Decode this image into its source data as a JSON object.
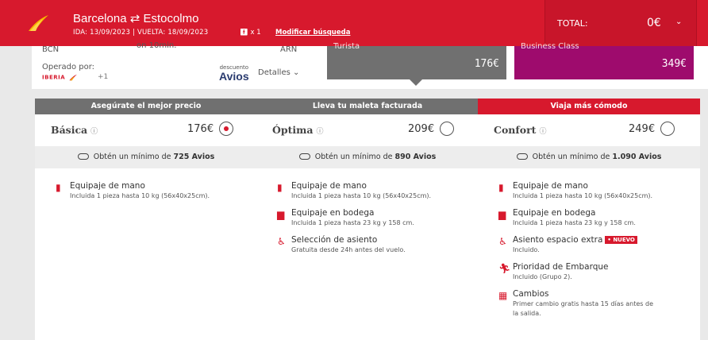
{
  "header": {
    "route": "Barcelona ⇄ Estocolmo",
    "dates": "IDA: 13/09/2023 | VUELTA: 18/09/2023",
    "pax": "x 1",
    "modify": "Modificar búsqueda",
    "total_label": "TOTAL:",
    "total_value": "0€"
  },
  "flight": {
    "origin": "BCN",
    "destination": "ARN",
    "duration": "on 10min.",
    "operated_label": "Operado por:",
    "airline": "IBERIA",
    "extra_carriers": "+1",
    "avios_top": "descuento",
    "avios_brand": "Avios",
    "details": "Detalles"
  },
  "fare_summary": [
    {
      "name": "Turista",
      "price": "176€"
    },
    {
      "name": "Business Class",
      "price": "349€"
    }
  ],
  "cards": [
    {
      "banner": "Asegúrate el mejor precio",
      "name": "Básica",
      "price": "176€",
      "avios_prefix": "Obtén un mínimo de",
      "avios_value": "725 Avios",
      "features": [
        {
          "title": "Equipaje de mano",
          "sub": "Incluida 1 pieza hasta 10 kg (56x40x25cm)."
        }
      ]
    },
    {
      "banner": "Lleva tu maleta facturada",
      "name": "Óptima",
      "price": "209€",
      "avios_prefix": "Obtén un mínimo de",
      "avios_value": "890 Avios",
      "features": [
        {
          "title": "Equipaje de mano",
          "sub": "Incluida 1 pieza hasta 10 kg (56x40x25cm)."
        },
        {
          "title": "Equipaje en bodega",
          "sub": "Incluida 1 pieza hasta 23 kg y 158 cm."
        },
        {
          "title": "Selección de asiento",
          "sub": "Gratuita desde 24h antes del vuelo."
        }
      ]
    },
    {
      "banner": "Viaja más cómodo",
      "name": "Confort",
      "price": "249€",
      "avios_prefix": "Obtén un mínimo de",
      "avios_value": "1.090 Avios",
      "features": [
        {
          "title": "Equipaje de mano",
          "sub": "Incluida 1 pieza hasta 10 kg (56x40x25cm)."
        },
        {
          "title": "Equipaje en bodega",
          "sub": "Incluida 1 pieza hasta 23 kg y 158 cm."
        },
        {
          "title": "Asiento espacio extra",
          "sub": "Incluido.",
          "badge": "• NUEVO"
        },
        {
          "title": "Prioridad de Embarque",
          "sub": "Incluido (Grupo 2)."
        },
        {
          "title": "Cambios",
          "sub": "Primer cambio gratis hasta 15 días antes de",
          "sub2": "la salida."
        }
      ]
    }
  ],
  "colors": {
    "brand_red": "#d7192d",
    "turista_gray": "#707070",
    "business_purple": "#9e0b6d"
  }
}
